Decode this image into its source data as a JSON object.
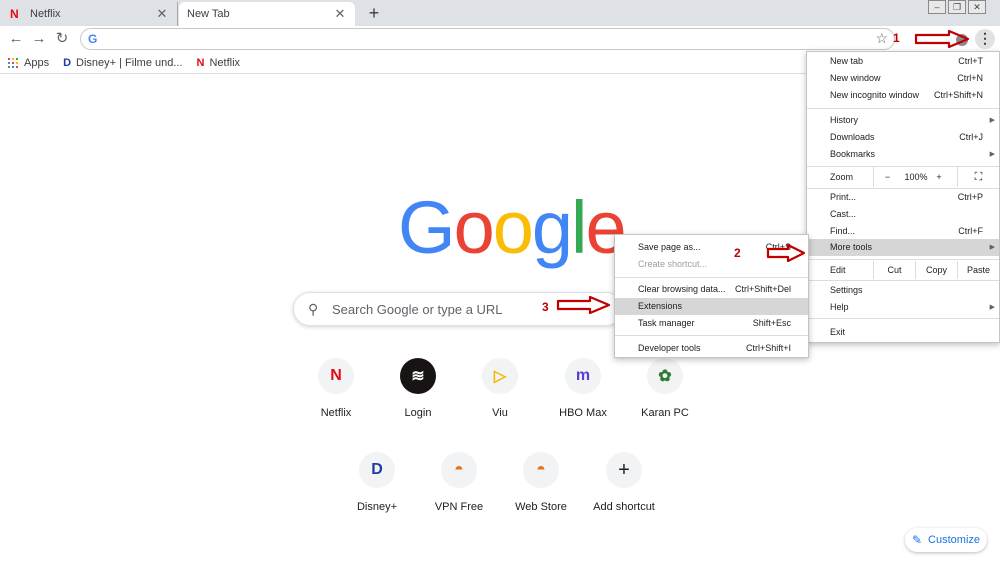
{
  "tabs": [
    {
      "label": "Netflix",
      "icon": "netflix-icon"
    },
    {
      "label": "New Tab"
    }
  ],
  "tab_close_glyph": "✕",
  "new_tab_glyph": "+",
  "bookmarks": [
    {
      "label": "Apps"
    },
    {
      "label": "Disney+ | Filme und..."
    },
    {
      "label": "Netflix"
    }
  ],
  "omnibox": {
    "value": ""
  },
  "logo": {
    "letters": [
      "G",
      "o",
      "o",
      "g",
      "l",
      "e"
    ],
    "colors": [
      "#4285f4",
      "#ea4335",
      "#fbbc05",
      "#4285f4",
      "#34a853",
      "#ea4335"
    ]
  },
  "search": {
    "placeholder": "Search Google or type a URL"
  },
  "shortcuts_row1": [
    {
      "label": "Netflix",
      "glyph": "N",
      "color": "#e50914"
    },
    {
      "label": "Login",
      "glyph": "≋",
      "color": "#191414"
    },
    {
      "label": "Viu",
      "glyph": "▷",
      "color": "#f5b800"
    },
    {
      "label": "HBO Max",
      "glyph": "m",
      "color": "#5b3fd1"
    },
    {
      "label": "Karan PC",
      "glyph": "✿",
      "color": "#2e7d32"
    }
  ],
  "shortcuts_row2": [
    {
      "label": "Disney+",
      "glyph": "D",
      "color": "#1d3ca8"
    },
    {
      "label": "VPN Free",
      "glyph": "◓",
      "color": "#e8711c"
    },
    {
      "label": "Web Store",
      "glyph": "◓",
      "color": "#e8711c"
    },
    {
      "label": "Add shortcut",
      "glyph": "+",
      "color": "#202124"
    }
  ],
  "customize": {
    "label": "Customize"
  },
  "menu": {
    "new_tab": {
      "label": "New tab",
      "shortcut": "Ctrl+T"
    },
    "new_window": {
      "label": "New window",
      "shortcut": "Ctrl+N"
    },
    "new_incognito": {
      "label": "New incognito window",
      "shortcut": "Ctrl+Shift+N"
    },
    "history": {
      "label": "History"
    },
    "downloads": {
      "label": "Downloads",
      "shortcut": "Ctrl+J"
    },
    "bookmarks": {
      "label": "Bookmarks"
    },
    "zoom": {
      "label": "Zoom",
      "minus": "−",
      "value": "100%",
      "plus": "+"
    },
    "print": {
      "label": "Print...",
      "shortcut": "Ctrl+P"
    },
    "cast": {
      "label": "Cast..."
    },
    "find": {
      "label": "Find...",
      "shortcut": "Ctrl+F"
    },
    "more_tools": {
      "label": "More tools"
    },
    "edit": {
      "label": "Edit",
      "cut": "Cut",
      "copy": "Copy",
      "paste": "Paste"
    },
    "settings": {
      "label": "Settings"
    },
    "help": {
      "label": "Help"
    },
    "exit": {
      "label": "Exit"
    }
  },
  "submenu": {
    "save_page": {
      "label": "Save page as...",
      "shortcut": "Ctrl+S"
    },
    "create_shortcut": {
      "label": "Create shortcut..."
    },
    "clear_browsing": {
      "label": "Clear browsing data...",
      "shortcut": "Ctrl+Shift+Del"
    },
    "extensions": {
      "label": "Extensions"
    },
    "task_manager": {
      "label": "Task manager",
      "shortcut": "Shift+Esc"
    },
    "developer_tools": {
      "label": "Developer tools",
      "shortcut": "Ctrl+Shift+I"
    }
  },
  "annotations": [
    "1",
    "2",
    "3"
  ],
  "colors": {
    "annotation": "#c00000",
    "link": "#1a73e8"
  }
}
